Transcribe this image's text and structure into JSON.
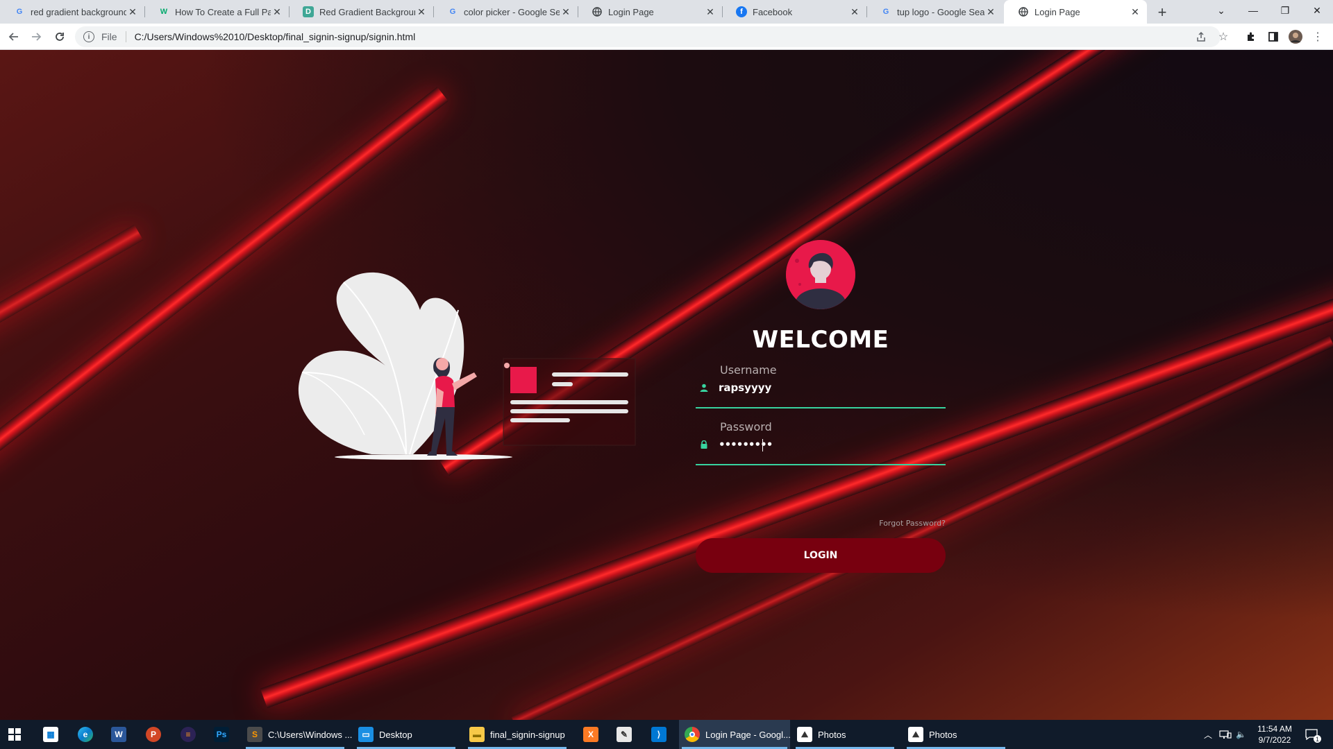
{
  "tabs": [
    {
      "title": "red gradient background -",
      "icon": "google-icon"
    },
    {
      "title": "How To Create a Full Page",
      "icon": "w3schools-icon"
    },
    {
      "title": "Red Gradient Background",
      "icon": "d-site-icon"
    },
    {
      "title": "color picker - Google Sear",
      "icon": "google-icon"
    },
    {
      "title": "Login Page",
      "icon": "globe-icon"
    },
    {
      "title": "Facebook",
      "icon": "facebook-icon"
    },
    {
      "title": "tup logo - Google Search",
      "icon": "google-icon"
    },
    {
      "title": "Login Page",
      "icon": "globe-icon",
      "active": true
    }
  ],
  "address_bar": {
    "scheme_label": "File",
    "url": "C:/Users/Windows%2010/Desktop/final_signin-signup/signin.html"
  },
  "form": {
    "heading": "WELCOME",
    "username_label": "Username",
    "username_value": "rapsyyyy",
    "password_label": "Password",
    "password_value": "•••••••••",
    "forgot_link": "Forgot Password?",
    "login_button": "LOGIN"
  },
  "colors": {
    "accent_pink": "#e8194a",
    "input_underline": "#38d39f",
    "button_bg": "#78000f",
    "beam_red": "#ff2a2a"
  },
  "taskbar": {
    "apps": [
      {
        "name": "start-icon",
        "label": ""
      },
      {
        "name": "store-icon",
        "label": ""
      },
      {
        "name": "edge-icon",
        "label": ""
      },
      {
        "name": "word-icon",
        "label": ""
      },
      {
        "name": "powerpoint-icon",
        "label": ""
      },
      {
        "name": "eclipse-icon",
        "label": ""
      },
      {
        "name": "photoshop-icon",
        "label": ""
      },
      {
        "name": "sublime-icon",
        "label": "C:\\Users\\Windows ..."
      },
      {
        "name": "desktop-icon",
        "label": "Desktop"
      },
      {
        "name": "explorer-icon",
        "label": "final_signin-signup"
      },
      {
        "name": "xampp-icon",
        "label": ""
      },
      {
        "name": "notepad-icon",
        "label": ""
      },
      {
        "name": "vscode-icon",
        "label": ""
      },
      {
        "name": "chrome-icon",
        "label": "Login Page - Googl..."
      },
      {
        "name": "photos-icon",
        "label": "Photos"
      },
      {
        "name": "photos-icon",
        "label": "Photos"
      }
    ],
    "time": "11:54 AM",
    "date": "9/7/2022",
    "notification_count": "1"
  }
}
